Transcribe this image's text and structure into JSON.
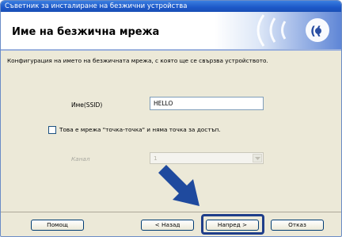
{
  "window": {
    "title": "Съветник за инсталиране на безжични устройства"
  },
  "header": {
    "title": "Име на безжична мрежа",
    "logo_icon": "wireless-signal-icon"
  },
  "main": {
    "description": "Конфигурация на името на безжичната мрежа, с която ще се свързва устройството.",
    "ssid_label": "Име(SSID)",
    "ssid_value": "HELLO",
    "adhoc_checkbox_label": "Това е мрежа \"точка-точка\" и няма точка за достъп.",
    "adhoc_checked": false,
    "channel_label": "Канал",
    "channel_value": "1"
  },
  "buttons": {
    "help": "Помощ",
    "back": "< Назад",
    "next": "Напред >",
    "cancel": "Отказ"
  },
  "colors": {
    "titlebar": "#1c58c8",
    "highlight": "#1f3e8a",
    "arrow": "#1f4a9e"
  }
}
